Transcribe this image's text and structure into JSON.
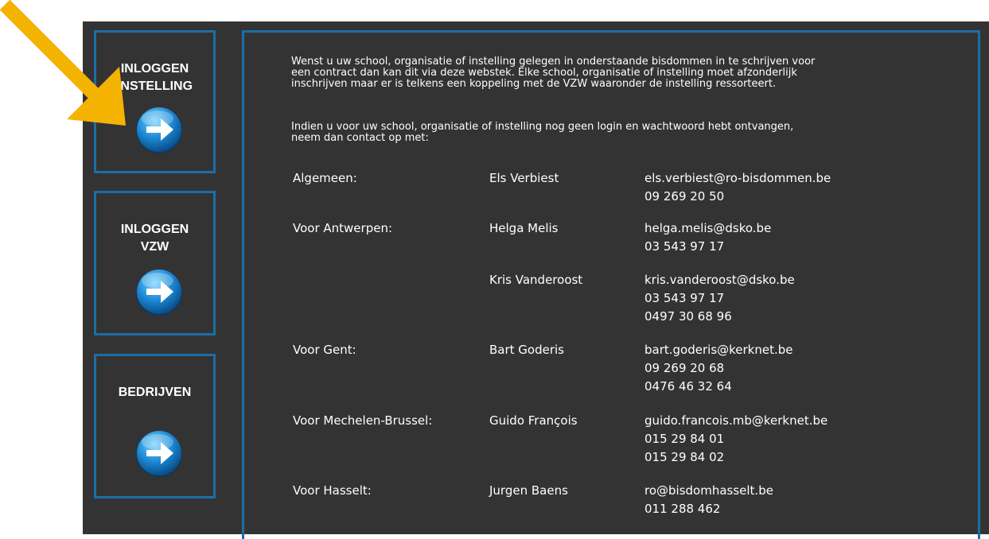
{
  "sidebar": {
    "buttons": [
      {
        "label_lines": [
          "INLOGGEN",
          "INSTELLING"
        ],
        "icon": "arrow-right-circle-icon"
      },
      {
        "label_lines": [
          "INLOGGEN",
          "VZW"
        ],
        "icon": "arrow-right-circle-icon"
      },
      {
        "label_lines": [
          "BEDRIJVEN"
        ],
        "icon": "arrow-right-circle-icon"
      }
    ]
  },
  "intro": {
    "paragraph1": "Wenst u uw school, organisatie of instelling gelegen in onderstaande bisdommen in te schrijven voor\neen contract dan kan dit via deze webstek. Elke school, organisatie of instelling moet afzonderlijk\ninschrijven maar er is telkens een koppeling met de VZW waaronder de instelling ressorteert.",
    "paragraph2": "Indien u voor uw school, organisatie of instelling nog geen login en wachtwoord hebt ontvangen,\nneem dan contact op met:"
  },
  "contacts": [
    {
      "region": "Algemeen:",
      "person": "Els Verbiest",
      "email": "els.verbiest@ro-bisdommen.be",
      "phones": [
        "09 269 20 50"
      ]
    },
    {
      "region": "Voor Antwerpen:",
      "person": "Helga Melis",
      "email": "helga.melis@dsko.be",
      "phones": [
        "03 543 97 17"
      ]
    },
    {
      "region": "",
      "person": "Kris Vanderoost",
      "email": "kris.vanderoost@dsko.be",
      "phones": [
        "03 543 97 17",
        "0497 30 68 96"
      ]
    },
    {
      "region": "Voor Gent:",
      "person": "Bart Goderis",
      "email": "bart.goderis@kerknet.be",
      "phones": [
        "09 269 20 68",
        "0476 46 32 64"
      ]
    },
    {
      "region": "Voor Mechelen-Brussel:",
      "person": "Guido François",
      "email": "guido.francois.mb@kerknet.be",
      "phones": [
        "015 29 84 01",
        "015 29 84 02"
      ]
    },
    {
      "region": "Voor Hasselt:",
      "person": "Jurgen Baens",
      "email": "ro@bisdomhasselt.be",
      "phones": [
        "011 288 462"
      ]
    }
  ],
  "colors": {
    "panel_background": "#333333",
    "border_blue": "#1a6ea8",
    "annotation_arrow": "#f5b301"
  },
  "annotation": {
    "icon": "pointer-arrow-icon"
  }
}
